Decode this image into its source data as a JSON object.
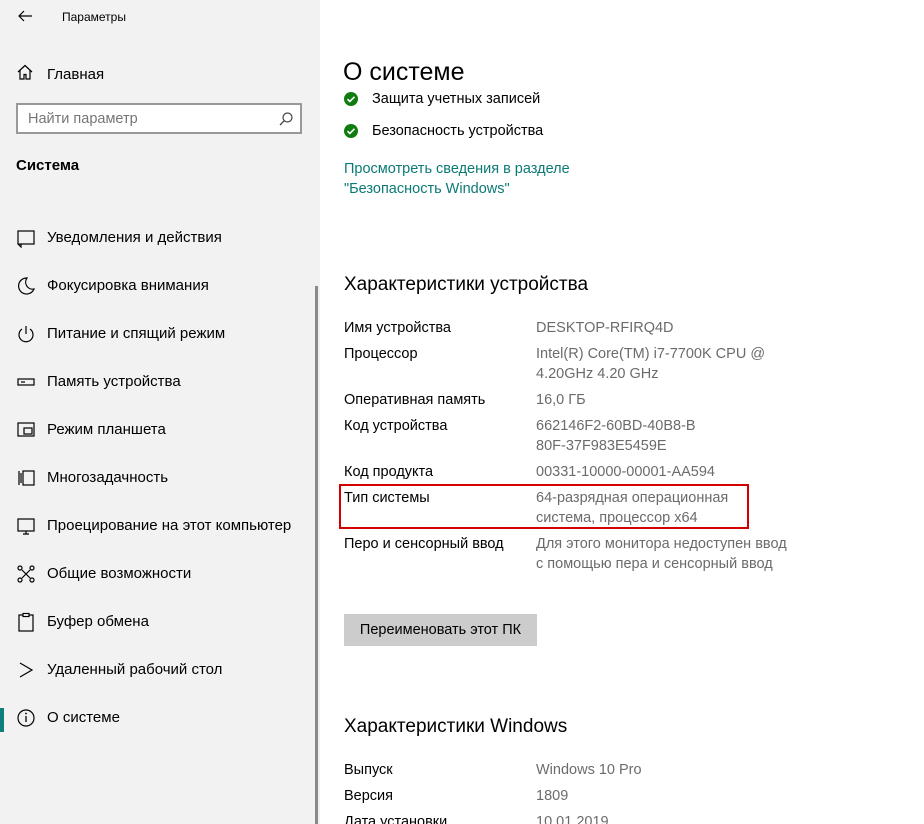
{
  "window": {
    "title": "Параметры"
  },
  "sidebar": {
    "home_label": "Главная",
    "search_placeholder": "Найти параметр",
    "section_title": "Система",
    "items": [
      {
        "label": "Уведомления и действия",
        "icon": "notifications-icon"
      },
      {
        "label": "Фокусировка внимания",
        "icon": "moon-icon"
      },
      {
        "label": "Питание и спящий режим",
        "icon": "power-icon"
      },
      {
        "label": "Память устройства",
        "icon": "storage-icon"
      },
      {
        "label": "Режим планшета",
        "icon": "tablet-icon"
      },
      {
        "label": "Многозадачность",
        "icon": "multitasking-icon"
      },
      {
        "label": "Проецирование на этот компьютер",
        "icon": "projector-icon"
      },
      {
        "label": "Общие возможности",
        "icon": "shared-experiences-icon"
      },
      {
        "label": "Буфер обмена",
        "icon": "clipboard-icon"
      },
      {
        "label": "Удаленный рабочий стол",
        "icon": "remote-desktop-icon"
      },
      {
        "label": "О системе",
        "icon": "info-icon",
        "active": true
      }
    ]
  },
  "main": {
    "title": "О системе",
    "security": [
      {
        "label": "Защита учетных записей",
        "status": "ok"
      },
      {
        "label": "Безопасность устройства",
        "status": "ok"
      }
    ],
    "security_link": "Просмотреть сведения в разделе \"Безопасность Windows\"",
    "device_specs": {
      "heading": "Характеристики устройства",
      "rows": [
        {
          "key": "Имя устройства",
          "value": "DESKTOP-RFIRQ4D"
        },
        {
          "key": "Процессор",
          "value": "Intel(R) Core(TM) i7-7700K CPU @ 4.20GHz   4.20 GHz"
        },
        {
          "key": "Оперативная память",
          "value": "16,0 ГБ"
        },
        {
          "key": "Код устройства",
          "value": "662146F2-60BD-40B8-B80F-37F983E5459E"
        },
        {
          "key": "Код продукта",
          "value": "00331-10000-00001-AA594"
        },
        {
          "key": "Тип системы",
          "value": "64-разрядная операционная система, процессор x64"
        },
        {
          "key": "Перо и сенсорный ввод",
          "value": "Для этого монитора недоступен ввод с помощью пера и сенсорный ввод"
        }
      ]
    },
    "rename_button": "Переименовать этот ПК",
    "windows_specs": {
      "heading": "Характеристики Windows",
      "rows": [
        {
          "key": "Выпуск",
          "value": "Windows 10 Pro"
        },
        {
          "key": "Версия",
          "value": "1809"
        },
        {
          "key": "Дата установки",
          "value": "10.01.2019"
        }
      ]
    }
  },
  "colors": {
    "accent": "#0e7e7a",
    "link": "#0b7a75",
    "check": "#107c10",
    "highlight": "#d40000",
    "sidebar_bg": "#f2f2f2"
  }
}
